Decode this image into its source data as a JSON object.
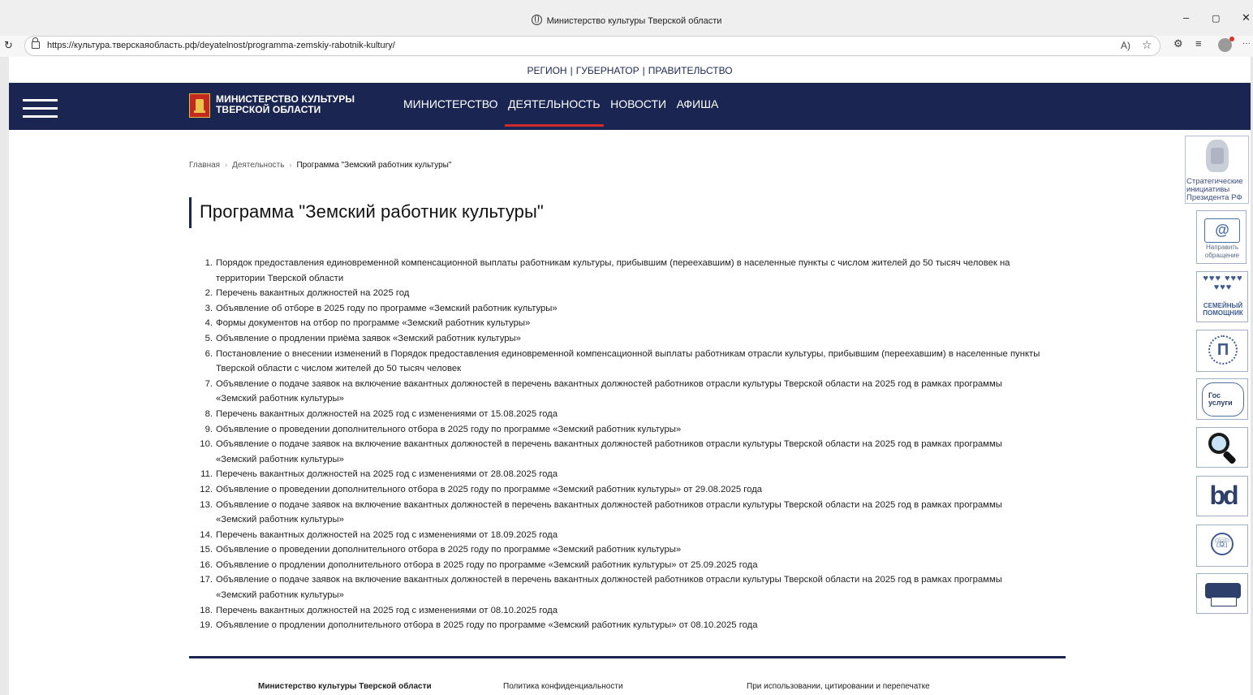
{
  "browser": {
    "window_title": "Министерство культуры Тверской области",
    "url": "https://культура.тверскаяобласть.рф/deyatelnost/programma-zemskiy-rabotnik-kultury/",
    "controls": {
      "minimize": "–",
      "restore": "▢",
      "close": "✕"
    },
    "toolbar": {
      "read_aloud": "A)",
      "favorite": "☆",
      "more": "···"
    }
  },
  "top_links": {
    "region": "РЕГИОН",
    "governor": "ГУБЕРНАТОР",
    "government": "ПРАВИТЕЛЬСТВО",
    "separator": "|"
  },
  "header": {
    "logo_line1": "МИНИСТЕРСТВО КУЛЬТУРЫ",
    "logo_line2": "ТВЕРСКОЙ ОБЛАСТИ",
    "nav": [
      "МИНИСТЕРСТВО",
      "ДЕЯТЕЛЬНОСТЬ",
      "НОВОСТИ",
      "АФИША"
    ],
    "active_nav": "ДЕЯТЕЛЬНОСТЬ"
  },
  "breadcrumb": {
    "items": [
      "Главная",
      "Деятельность"
    ],
    "current": "Программа \"Земский работник культуры\"",
    "separator": "›"
  },
  "page": {
    "title": "Программа \"Земский работник культуры\""
  },
  "documents": [
    {
      "num": "1.",
      "title": "Порядок предоставления единовременной компенсационной выплаты работникам культуры, прибывшим (переехавшим) в населенные пункты с числом жителей до 50 тысяч человек на территории Тверской области"
    },
    {
      "num": "2.",
      "title": "Перечень вакантных должностей на 2025 год"
    },
    {
      "num": "3.",
      "title": "Объявление об отборе в 2025 году по программе «Земский работник культуры»"
    },
    {
      "num": "4.",
      "title": "Формы документов на отбор по программе «Земский работник культуры»"
    },
    {
      "num": "5.",
      "title": "Объявление о продлении приёма заявок «Земский работник культуры»"
    },
    {
      "num": "6.",
      "title": "Постановление о внесении изменений в Порядок предоставления единовременной компенсационной выплаты работникам отрасли культуры, прибывшим (переехавшим) в населенные пункты Тверской области с числом жителей до 50 тысяч человек"
    },
    {
      "num": "7.",
      "title": "Объявление о подаче заявок на включение вакантных должностей в перечень вакантных должностей работников отрасли культуры Тверской области на 2025 год в рамках программы «Земский работник культуры»"
    },
    {
      "num": "8.",
      "title": "Перечень вакантных должностей на 2025 год с изменениями от 15.08.2025 года"
    },
    {
      "num": "9.",
      "title": "Объявление о проведении дополнительного отбора в 2025 году по программе «Земский работник культуры»"
    },
    {
      "num": "10.",
      "title": "Объявление о подаче заявок на включение вакантных должностей в перечень вакантных должностей работников отрасли культуры Тверской области на 2025 год в рамках программы «Земский работник культуры»"
    },
    {
      "num": "11.",
      "title": "Перечень вакантных должностей на 2025 год с изменениями от 28.08.2025 года"
    },
    {
      "num": "12.",
      "title": "Объявление о проведении дополнительного отбора в 2025 году по программе «Земский работник культуры» от 29.08.2025 года"
    },
    {
      "num": "13.",
      "title": "Объявление о подаче заявок на включение вакантных должностей в перечень вакантных должностей работников отрасли культуры Тверской области на 2025 год в рамках программы «Земский работник культуры»"
    },
    {
      "num": "14.",
      "title": "Перечень вакантных должностей на 2025 год с изменениями от 18.09.2025 года"
    },
    {
      "num": "15.",
      "title": "Объявление о проведении дополнительного отбора в 2025 году по программе «Земский работник культуры»"
    },
    {
      "num": "16.",
      "title": "Объявление о продлении дополнительного отбора в 2025 году по программе «Земский работник культуры» от 25.09.2025 года"
    },
    {
      "num": "17.",
      "title": "Объявление о подаче заявок на включение вакантных должностей в перечень вакантных должностей работников отрасли культуры Тверской области на 2025 год в рамках программы «Земский работник культуры»"
    },
    {
      "num": "18.",
      "title": "Перечень вакантных должностей на 2025 год с изменениями от 08.10.2025 года"
    },
    {
      "num": "19.",
      "title": "Объявление о продлении дополнительного отбора в 2025 году по программе «Земский работник культуры» от 08.10.2025 года"
    }
  ],
  "footer": {
    "org_name": "Министерство культуры Тверской области",
    "privacy": "Политика конфиденциальности",
    "usage_notice": "При использовании, цитировании и перепечатке"
  },
  "widgets": {
    "strategic": "Стратегические инициативы Президента РФ",
    "appeal_line1": "Направить",
    "appeal_line2": "обращение",
    "appeal_symbol": "@",
    "family_line1": "СЕМЕЙНЫЙ",
    "family_line2": "ПОМОЩНИК",
    "family_hearts": "♥♥♥ ♥♥♥ ♥♥♥",
    "pushkin_symbol": "П",
    "gos_line1": "Гос",
    "gos_line2": "услуги",
    "eye_glyph": "bd",
    "phone_glyph": "☏"
  }
}
